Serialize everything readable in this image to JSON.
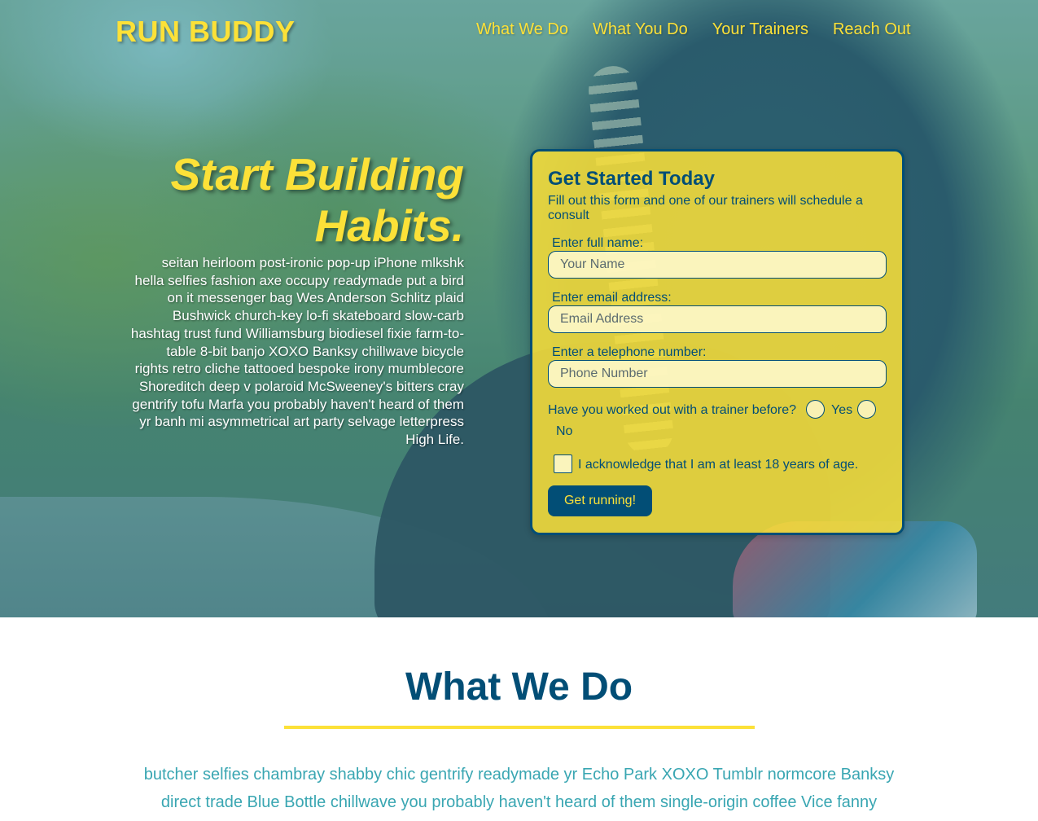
{
  "header": {
    "logo": "RUN BUDDY",
    "nav": [
      "What We Do",
      "What You Do",
      "Your Trainers",
      "Reach Out"
    ]
  },
  "hero": {
    "title": "Start Building Habits.",
    "body": "seitan heirloom post-ironic pop-up iPhone mlkshk hella selfies fashion axe occupy readymade put a bird on it messenger bag Wes Anderson Schlitz plaid Bushwick church-key lo-fi skateboard slow-carb hashtag trust fund Williamsburg biodiesel fixie farm-to-table 8-bit banjo XOXO Banksy chillwave bicycle rights retro cliche tattooed bespoke irony mumblecore Shoreditch deep v polaroid McSweeney's bitters cray gentrify tofu Marfa you probably haven't heard of them yr banh mi asymmetrical art party selvage letterpress High Life."
  },
  "form": {
    "title": "Get Started Today",
    "subtitle": "Fill out this form and one of our trainers will schedule a consult",
    "name_label": "Enter full name:",
    "name_placeholder": "Your Name",
    "email_label": "Enter email address:",
    "email_placeholder": "Email Address",
    "phone_label": "Enter a telephone number:",
    "phone_placeholder": "Phone Number",
    "trainer_question": "Have you worked out with a trainer before?",
    "yes_label": "Yes",
    "no_label": "No",
    "age_ack": "I acknowledge that I am at least 18 years of age.",
    "submit_label": "Get running!"
  },
  "what_we_do": {
    "title": "What We Do",
    "body_line1": "butcher selfies chambray shabby chic gentrify readymade yr Echo Park XOXO Tumblr normcore Banksy",
    "body_line2": "direct trade Blue Bottle chillwave you probably haven't heard of them single-origin coffee Vice fanny"
  },
  "colors": {
    "brand_yellow": "#fce138",
    "brand_navy": "#024e76",
    "accent_teal": "#39a6b2"
  }
}
